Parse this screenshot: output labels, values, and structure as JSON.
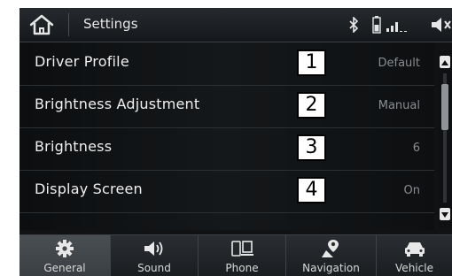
{
  "header": {
    "title": "Settings",
    "icons": [
      "home-icon",
      "bluetooth-icon",
      "battery-icon",
      "signal-icon",
      "speaker-icon"
    ]
  },
  "settings": {
    "rows": [
      {
        "label": "Driver Profile",
        "value": "Default",
        "callout": "1"
      },
      {
        "label": "Brightness Adjustment",
        "value": "Manual",
        "callout": "2"
      },
      {
        "label": "Brightness",
        "value": "6",
        "callout": "3"
      },
      {
        "label": "Display Screen",
        "value": "On",
        "callout": "4"
      }
    ]
  },
  "nav": {
    "tabs": [
      {
        "label": "General",
        "icon": "gear-icon",
        "active": true
      },
      {
        "label": "Sound",
        "icon": "speaker-icon",
        "active": false
      },
      {
        "label": "Phone",
        "icon": "phone-icon",
        "active": false
      },
      {
        "label": "Navigation",
        "icon": "map-pin-icon",
        "active": false
      },
      {
        "label": "Vehicle",
        "icon": "car-icon",
        "active": false
      }
    ]
  }
}
